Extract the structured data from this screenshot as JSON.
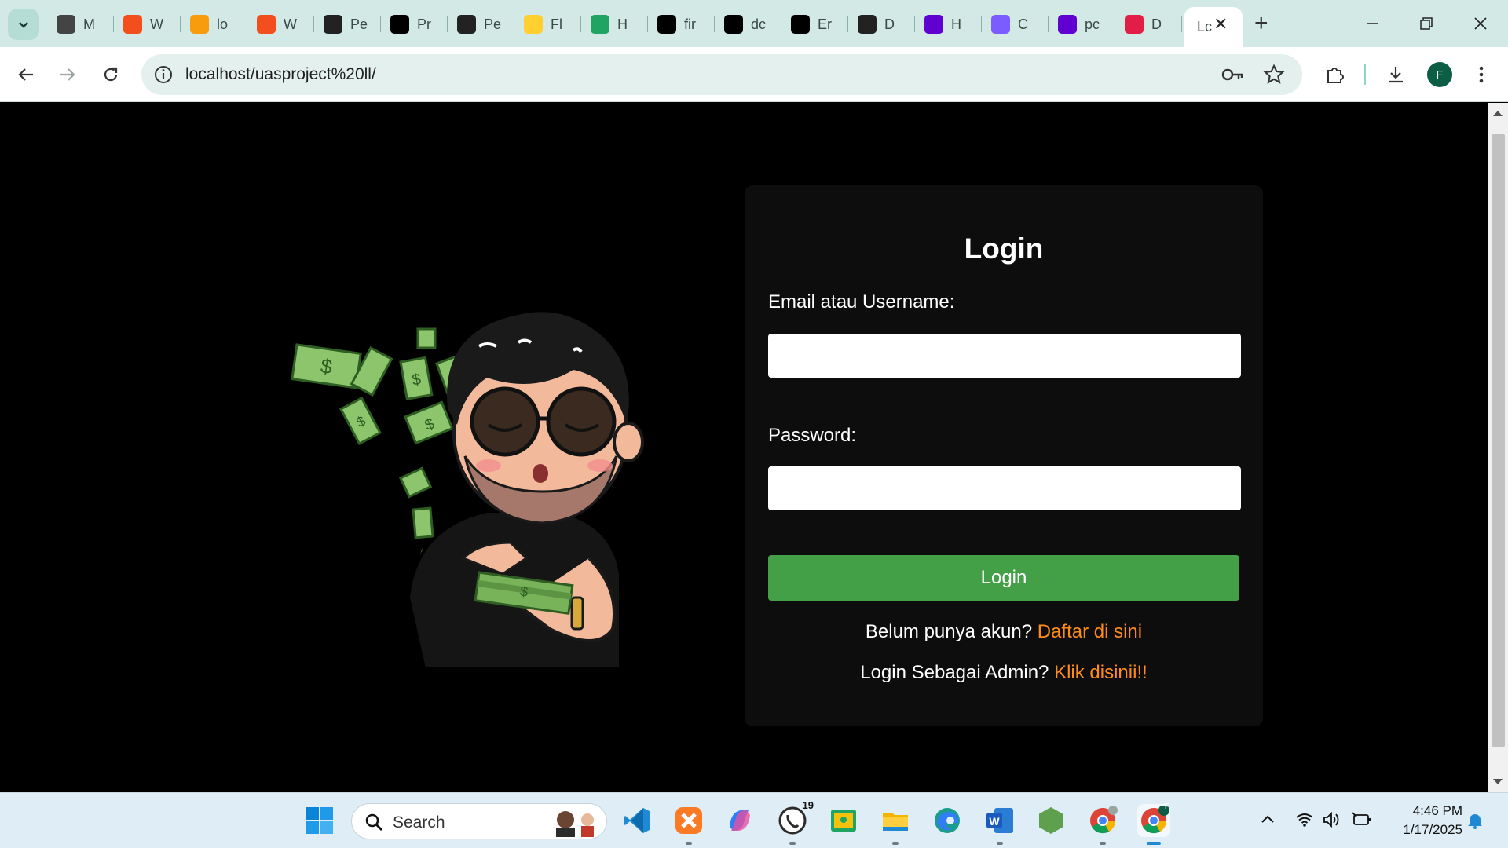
{
  "browser": {
    "tabs": [
      {
        "label": "M",
        "icon": "globe-icon",
        "color": "#444444"
      },
      {
        "label": "W",
        "icon": "figma-icon",
        "color": "#f24e1e"
      },
      {
        "label": "lo",
        "icon": "phpmyadmin-icon",
        "color": "#f89c0e"
      },
      {
        "label": "W",
        "icon": "figma-icon",
        "color": "#f24e1e"
      },
      {
        "label": "Pe",
        "icon": "openai-icon",
        "color": "#222222"
      },
      {
        "label": "Pr",
        "icon": "notion-icon",
        "color": "#000000"
      },
      {
        "label": "Pe",
        "icon": "codepen-icon",
        "color": "#222222"
      },
      {
        "label": "Fl",
        "icon": "miro-icon",
        "color": "#ffd02f"
      },
      {
        "label": "H",
        "icon": "drive-icon",
        "color": "#1fa463"
      },
      {
        "label": "fir",
        "icon": "github-icon",
        "color": "#000000"
      },
      {
        "label": "dc",
        "icon": "vercel-icon",
        "color": "#000000"
      },
      {
        "label": "Er",
        "icon": "vercel-icon",
        "color": "#000000"
      },
      {
        "label": "D",
        "icon": "codepen-icon",
        "color": "#222222"
      },
      {
        "label": "H",
        "icon": "yahoo-icon",
        "color": "#6001d2"
      },
      {
        "label": "C",
        "icon": "canva-like-icon",
        "color": "#7b5cff"
      },
      {
        "label": "pc",
        "icon": "yahoo-icon",
        "color": "#6001d2"
      },
      {
        "label": "D",
        "icon": "heart-icon",
        "color": "#e11d48"
      }
    ],
    "active_tab": {
      "label": "Lc"
    },
    "url": "localhost/uasproject%20ll/",
    "profile_initial": "F"
  },
  "login": {
    "title": "Login",
    "email_label": "Email atau Username:",
    "email_value": "",
    "password_label": "Password:",
    "password_value": "",
    "submit_label": "Login",
    "register_prompt": "Belum punya akun?",
    "register_link": "Daftar di sini",
    "admin_prompt": "Login Sebagai Admin?",
    "admin_link": "Klik disinii!!"
  },
  "taskbar": {
    "search_label": "Search",
    "whatsapp_badge": "19",
    "chrome_profile_badge": "F",
    "time": "4:46 PM",
    "date": "1/17/2025"
  }
}
